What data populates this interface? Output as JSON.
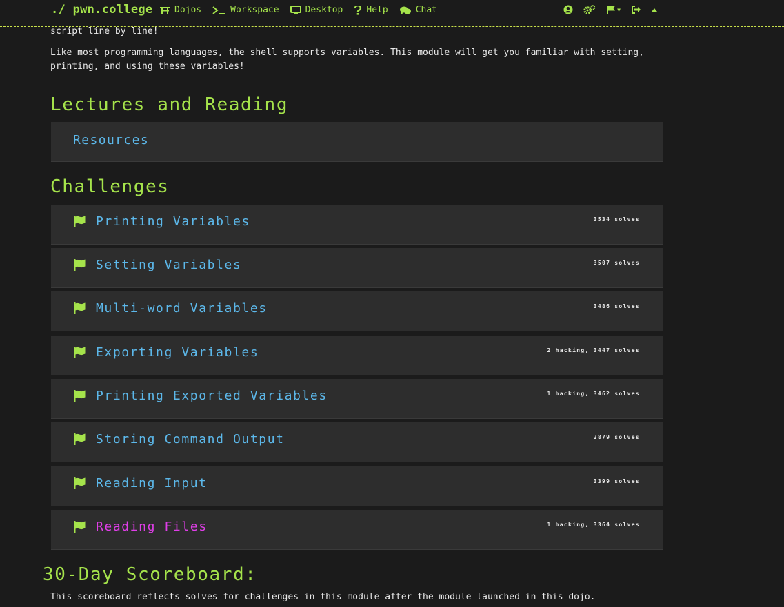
{
  "nav": {
    "brand": "./ pwn.college",
    "items": [
      {
        "label": "Dojos",
        "icon": "dojo-icon"
      },
      {
        "label": "Workspace",
        "icon": "terminal-icon"
      },
      {
        "label": "Desktop",
        "icon": "monitor-icon"
      },
      {
        "label": "Help",
        "icon": "question-icon"
      },
      {
        "label": "Chat",
        "icon": "chat-icon"
      }
    ],
    "accent": "#a5e34b"
  },
  "intro": {
    "top_line": "script line by line!",
    "paragraph": "Like most programming languages, the shell supports variables. This module will get you familiar with setting, printing, and using these variables!"
  },
  "lectures": {
    "heading": "Lectures and Reading",
    "resources_label": "Resources"
  },
  "challenges": {
    "heading": "Challenges",
    "items": [
      {
        "title": "Printing Variables",
        "stats": "3534 solves"
      },
      {
        "title": "Setting Variables",
        "stats": "3507 solves"
      },
      {
        "title": "Multi-word Variables",
        "stats": "3486 solves"
      },
      {
        "title": "Exporting Variables",
        "stats": "2 hacking, 3447 solves"
      },
      {
        "title": "Printing Exported Variables",
        "stats": "1 hacking, 3462 solves"
      },
      {
        "title": "Storing Command Output",
        "stats": "2879 solves"
      },
      {
        "title": "Reading Input",
        "stats": "3399 solves"
      },
      {
        "title": "Reading Files",
        "stats": "1 hacking, 3364 solves"
      }
    ],
    "colors": {
      "title": "#5cb8ea",
      "active": "#e03ee8",
      "flag": "#a5e34b"
    }
  },
  "scoreboard": {
    "heading": "30-Day Scoreboard:",
    "text": "This scoreboard reflects solves for challenges in this module after the module launched in this dojo."
  }
}
